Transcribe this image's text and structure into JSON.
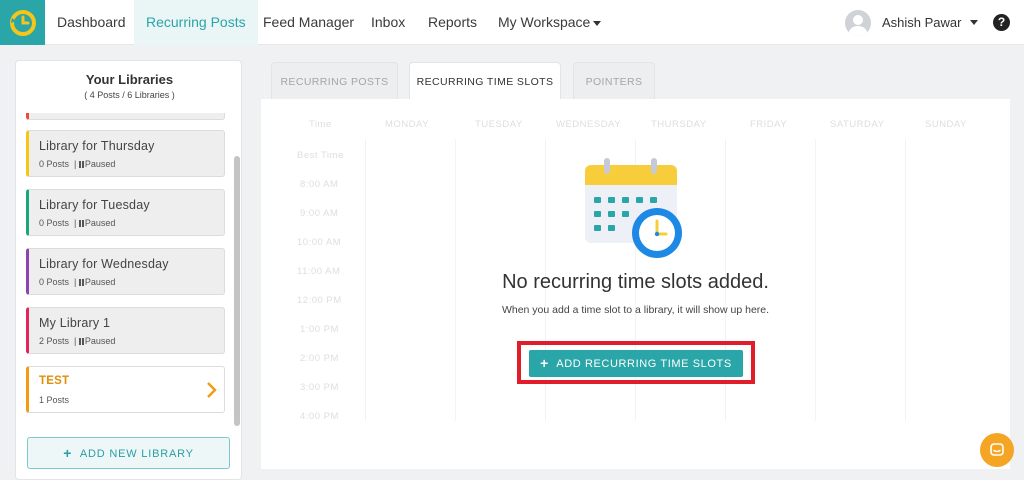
{
  "nav": {
    "items": [
      {
        "label": "Dashboard"
      },
      {
        "label": "Recurring Posts"
      },
      {
        "label": "Feed Manager"
      },
      {
        "label": "Inbox"
      },
      {
        "label": "Reports"
      },
      {
        "label": "My Workspace"
      }
    ],
    "user_name": "Ashish Pawar",
    "help_glyph": "?"
  },
  "sidebar": {
    "title": "Your Libraries",
    "subtitle": "( 4 Posts / 6 Libraries )",
    "libraries": [
      {
        "name": "Library for Thursday",
        "posts": "0 Posts",
        "status": "Paused",
        "color": "#f5c518"
      },
      {
        "name": "Library for Tuesday",
        "posts": "0 Posts",
        "status": "Paused",
        "color": "#1aa57a"
      },
      {
        "name": "Library for Wednesday",
        "posts": "0 Posts",
        "status": "Paused",
        "color": "#8e44ad"
      },
      {
        "name": "My Library 1",
        "posts": "2 Posts",
        "status": "Paused",
        "color": "#e0245e"
      },
      {
        "name": "TEST",
        "posts": "1 Posts",
        "status": "",
        "color": "#f39c12"
      }
    ],
    "add_button": "ADD NEW LIBRARY"
  },
  "tabs": [
    {
      "label": "RECURRING POSTS"
    },
    {
      "label": "RECURRING TIME SLOTS"
    },
    {
      "label": "POINTERS"
    }
  ],
  "grid": {
    "time_header": "Time",
    "days": [
      "MONDAY",
      "TUESDAY",
      "WEDNESDAY",
      "THURSDAY",
      "FRIDAY",
      "SATURDAY",
      "SUNDAY"
    ],
    "times": [
      "Best Time",
      "8:00 AM",
      "9:00 AM",
      "10:00 AM",
      "11:00 AM",
      "12:00 PM",
      "1:00 PM",
      "2:00 PM",
      "3:00 PM",
      "4:00 PM"
    ]
  },
  "empty_state": {
    "icon": "calendar-clock-icon",
    "title": "No recurring time slots added.",
    "subtitle": "When you add a time slot to a library, it will show up here.",
    "button": "ADD RECURRING TIME SLOTS"
  },
  "colors": {
    "accent": "#2aa5a8",
    "highlight": "#e11d2a",
    "chat": "#f5a524"
  }
}
